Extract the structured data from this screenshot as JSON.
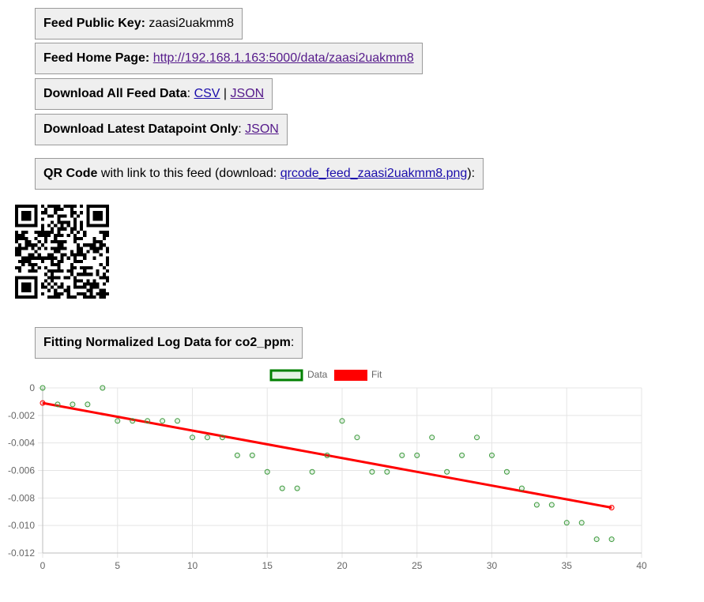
{
  "info": {
    "public_key_label": "Feed Public Key:",
    "public_key_value": "zaasi2uakmm8",
    "home_label": "Feed Home Page:",
    "home_link": "http://192.168.1.163:5000/data/zaasi2uakmm8",
    "download_all_label": "Download All Feed Data",
    "csv_link": "CSV",
    "json_link": "JSON",
    "separator": "|",
    "colon": ":",
    "download_latest_label": "Download Latest Datapoint Only",
    "latest_json_link": "JSON",
    "qr_label": "QR Code",
    "qr_text_pre": "with link to this feed (download:",
    "qr_link": "qrcode_feed_zaasi2uakmm8.png",
    "qr_text_post": "):",
    "fit_label": "Fitting Normalized Log Data for co2_ppm",
    "fit_colon": ":"
  },
  "chart_data": {
    "type": "scatter",
    "title": "",
    "xlabel": "",
    "ylabel": "",
    "xlim": [
      0,
      40
    ],
    "ylim": [
      -0.012,
      0
    ],
    "x_ticks": [
      0,
      5,
      10,
      15,
      20,
      25,
      30,
      35,
      40
    ],
    "y_ticks": [
      0,
      -0.002,
      -0.004,
      -0.006,
      -0.008,
      -0.01,
      -0.012
    ],
    "y_tick_labels": [
      "0",
      "-0.002",
      "-0.004",
      "-0.006",
      "-0.008",
      "-0.010",
      "-0.012"
    ],
    "grid": true,
    "legend_position": "top",
    "series": [
      {
        "name": "Data",
        "color": "#008000",
        "points": [
          [
            0,
            0
          ],
          [
            1,
            -0.0012
          ],
          [
            2,
            -0.0012
          ],
          [
            3,
            -0.0012
          ],
          [
            4,
            0
          ],
          [
            5,
            -0.0024
          ],
          [
            6,
            -0.0024
          ],
          [
            7,
            -0.0024
          ],
          [
            8,
            -0.0024
          ],
          [
            9,
            -0.0024
          ],
          [
            10,
            -0.0036
          ],
          [
            11,
            -0.0036
          ],
          [
            12,
            -0.0036
          ],
          [
            13,
            -0.0049
          ],
          [
            14,
            -0.0049
          ],
          [
            15,
            -0.0061
          ],
          [
            16,
            -0.0073
          ],
          [
            17,
            -0.0073
          ],
          [
            18,
            -0.0061
          ],
          [
            19,
            -0.0049
          ],
          [
            20,
            -0.0024
          ],
          [
            21,
            -0.0036
          ],
          [
            22,
            -0.0061
          ],
          [
            23,
            -0.0061
          ],
          [
            24,
            -0.0049
          ],
          [
            25,
            -0.0049
          ],
          [
            26,
            -0.0036
          ],
          [
            27,
            -0.0061
          ],
          [
            28,
            -0.0049
          ],
          [
            29,
            -0.0036
          ],
          [
            30,
            -0.0049
          ],
          [
            31,
            -0.0061
          ],
          [
            32,
            -0.0073
          ],
          [
            33,
            -0.0085
          ],
          [
            34,
            -0.0085
          ],
          [
            35,
            -0.0098
          ],
          [
            36,
            -0.0098
          ],
          [
            37,
            -0.011
          ],
          [
            38,
            -0.011
          ]
        ]
      },
      {
        "name": "Fit",
        "color": "#ff0000",
        "points": [
          [
            0,
            -0.0011
          ],
          [
            38,
            -0.0087
          ]
        ]
      }
    ]
  }
}
